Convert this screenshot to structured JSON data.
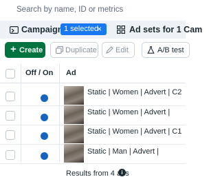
{
  "search": {
    "placeholder": "Search by name, ID or metrics"
  },
  "context": {
    "campaigns_label": "Campaigns",
    "selected_chip": "1 selected",
    "chip_close": "×",
    "adsets_label": "Ad sets for 1 Cam"
  },
  "toolbar": {
    "create": "Create",
    "create_icon": "+",
    "duplicate": "Duplicate",
    "edit": "Edit",
    "ab_test": "A/B test"
  },
  "table": {
    "headers": {
      "off_on": "Off / On",
      "ad": "Ad"
    },
    "rows": [
      {
        "name": "Static | Women | Advert | C2",
        "on": true
      },
      {
        "name": "Static | Women | Advert |",
        "on": true
      },
      {
        "name": "Static | Women | Advert | C1",
        "on": true
      },
      {
        "name": "Static | Man | Advert |",
        "on": true
      }
    ]
  },
  "footer": {
    "results": "Results from 4 ads",
    "info_icon": "i"
  },
  "colors": {
    "primary": "#1877f2",
    "create_green": "#00743f",
    "toggle_blue": "#1565c0",
    "context_bg": "#eef2f6"
  }
}
